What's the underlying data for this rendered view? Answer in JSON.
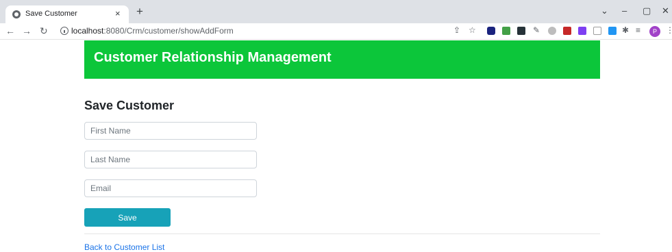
{
  "browser": {
    "tab_title": "Save Customer",
    "tab_close": "×",
    "new_tab": "+",
    "url_host": "localhost",
    "url_path": ":8080/Crm/customer/showAddForm",
    "profile_initial": "P",
    "window_minimize": "–",
    "window_restore": "▢",
    "window_close": "✕",
    "tab_search": "⌄"
  },
  "header": {
    "title": "Customer Relationship Management",
    "color": "#0cc63a"
  },
  "form": {
    "heading": "Save Customer",
    "first_name_placeholder": "First Name",
    "last_name_placeholder": "Last Name",
    "email_placeholder": "Email",
    "save_label": "Save",
    "save_color": "#17a2b8"
  },
  "footer": {
    "back_link": "Back to Customer List"
  }
}
